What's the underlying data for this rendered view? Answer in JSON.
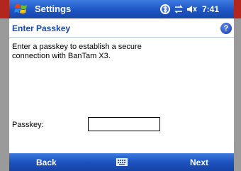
{
  "titlebar": {
    "app_title": "Settings",
    "clock": "7:41",
    "icons": [
      "windows-start-icon",
      "bluetooth-icon",
      "connectivity-icon",
      "volume-icon"
    ]
  },
  "header": {
    "title": "Enter Passkey",
    "help_icon": "question-mark-icon",
    "help_glyph": "?"
  },
  "body": {
    "instructions": "Enter a passkey to establish a secure connection with BanTam X3.",
    "passkey_label": "Passkey:",
    "passkey_value": ""
  },
  "softkeys": {
    "left": "Back",
    "right": "Next",
    "center_icon": "keyboard-icon"
  },
  "colors": {
    "title_bar": "#1d55c4",
    "header_text": "#1a47a8",
    "frame_red": "#b3261e"
  }
}
